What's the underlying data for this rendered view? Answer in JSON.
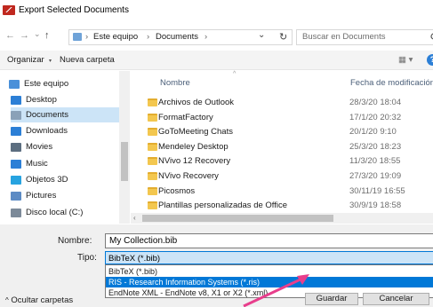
{
  "window": {
    "title": "Export Selected Documents"
  },
  "nav": {
    "back": "←",
    "forward": "→",
    "recent": "⌄",
    "up": "↑",
    "breadcrumb": [
      "Este equipo",
      "Documents"
    ],
    "separator": "›",
    "dropdown": "⌄",
    "refresh": "↻"
  },
  "search": {
    "placeholder": "Buscar en Documents",
    "icon": "search-icon"
  },
  "toolbar": {
    "organize": "Organizar",
    "new_folder": "Nueva carpeta",
    "view_label": "▦ ▾",
    "help": "?"
  },
  "sidebar": {
    "items": [
      {
        "label": "Este equipo",
        "icon": "computer-icon",
        "color": "#4a90d9",
        "selected": false
      },
      {
        "label": "Desktop",
        "icon": "desktop-icon",
        "color": "#2c7fd6",
        "selected": false
      },
      {
        "label": "Documents",
        "icon": "documents-icon",
        "color": "#8aa1b8",
        "selected": true
      },
      {
        "label": "Downloads",
        "icon": "downloads-icon",
        "color": "#2c7fd6",
        "selected": false
      },
      {
        "label": "Movies",
        "icon": "movies-icon",
        "color": "#5c6e80",
        "selected": false
      },
      {
        "label": "Music",
        "icon": "music-icon",
        "color": "#2c7fd6",
        "selected": false
      },
      {
        "label": "Objetos 3D",
        "icon": "objects-3d-icon",
        "color": "#27a3e0",
        "selected": false
      },
      {
        "label": "Pictures",
        "icon": "pictures-icon",
        "color": "#5c8bc4",
        "selected": false
      },
      {
        "label": "Disco local (C:)",
        "icon": "drive-icon",
        "color": "#7c8a99",
        "selected": false
      }
    ]
  },
  "filelist": {
    "columns": {
      "name": "Nombre",
      "date": "Fecha de modificación"
    },
    "rows": [
      {
        "name": "Archivos de Outlook",
        "date": "28/3/20 18:04"
      },
      {
        "name": "FormatFactory",
        "date": "17/1/20 20:32"
      },
      {
        "name": "GoToMeeting Chats",
        "date": "20/1/20 9:10"
      },
      {
        "name": "Mendeley Desktop",
        "date": "25/3/20 18:23"
      },
      {
        "name": "NVivo 12 Recovery",
        "date": "11/3/20 18:55"
      },
      {
        "name": "NVivo Recovery",
        "date": "27/3/20 19:09"
      },
      {
        "name": "Picosmos",
        "date": "30/11/19 16:55"
      },
      {
        "name": "Plantillas personalizadas de Office",
        "date": "30/9/19 18:58"
      }
    ]
  },
  "form": {
    "filename_label": "Nombre:",
    "filename_value": "My Collection.bib",
    "type_label": "Tipo:",
    "type_value": "BibTeX (*.bib)",
    "type_options": [
      {
        "label": "BibTeX (*.bib)",
        "highlighted": false
      },
      {
        "label": "RIS - Research Information Systems (*.ris)",
        "highlighted": true
      },
      {
        "label": "EndNote XML - EndNote v8, X1 or X2 (*.xml)",
        "highlighted": false
      }
    ]
  },
  "footer": {
    "hide_folders": "Ocultar carpetas",
    "save": "Guardar",
    "cancel": "Cancelar"
  },
  "colors": {
    "accent": "#0078d7",
    "selection": "#cce4f7",
    "arrow": "#e83e8c",
    "folder": "#f3c74f"
  }
}
